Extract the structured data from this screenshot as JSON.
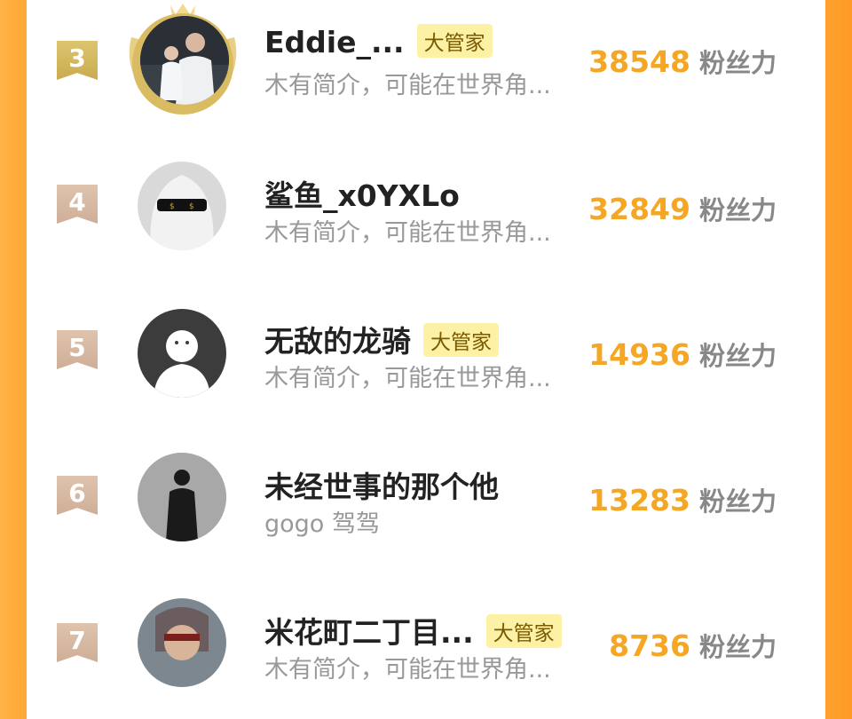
{
  "rows": [
    {
      "rank": "3",
      "name": "Eddie_...",
      "badge": "大管家",
      "bio": "木有简介，可能在世界角...",
      "score": "38548",
      "unit": "粉丝力",
      "avatar": "family-photo"
    },
    {
      "rank": "4",
      "name": "鲨鱼_x0YXLo",
      "badge": "",
      "bio": "木有简介，可能在世界角...",
      "score": "32849",
      "unit": "粉丝力",
      "avatar": "ghost-sunglasses"
    },
    {
      "rank": "5",
      "name": "无敌的龙骑",
      "badge": "大管家",
      "bio": "木有简介，可能在世界角...",
      "score": "14936",
      "unit": "粉丝力",
      "avatar": "default-user"
    },
    {
      "rank": "6",
      "name": "未经世事的那个他",
      "badge": "",
      "bio": "gogo 驾驾",
      "score": "13283",
      "unit": "粉丝力",
      "avatar": "silhouette-person"
    },
    {
      "rank": "7",
      "name": "米花町二丁目...",
      "badge": "大管家",
      "bio": "木有简介，可能在世界角...",
      "score": "8736",
      "unit": "粉丝力",
      "avatar": "anime-character"
    }
  ],
  "colors": {
    "accent": "#f5a623",
    "badge_bg": "#fdf1a6",
    "gold_rank": "#d4b95c",
    "plain_rank": "#d8b9a2"
  }
}
